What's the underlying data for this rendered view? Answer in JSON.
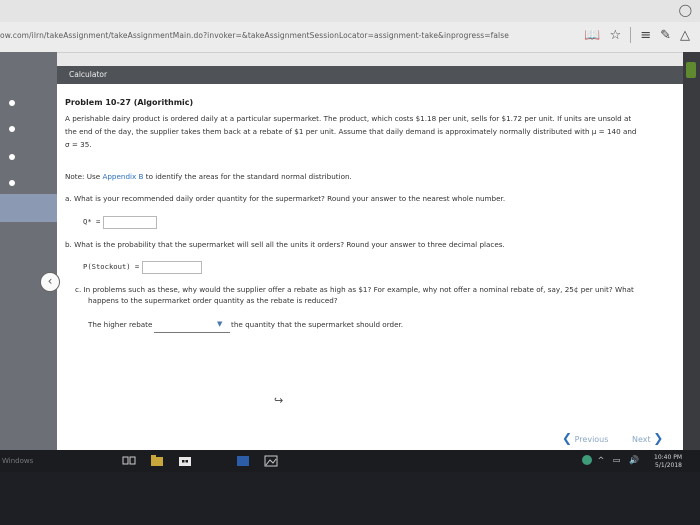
{
  "browser": {
    "url": "ow.com/ilrn/takeAssignment/takeAssignmentMain.do?invoker=&takeAssignmentSessionLocator=assignment-take&inprogress=false",
    "icons": [
      "reading-view-icon",
      "star-icon",
      "hub-icon",
      "note-icon",
      "share-icon"
    ]
  },
  "toolbar": {
    "calculator_label": "Calculator"
  },
  "problem": {
    "title": "Problem 10-27 (Algorithmic)",
    "text_line1": "A perishable dairy product is ordered daily at a particular supermarket. The product, which costs $1.18 per unit, sells for $1.72 per unit. If units are unsold at",
    "text_line2": "the end of the day, the supplier takes them back at a rebate of $1 per unit. Assume that daily demand is approximately normally distributed with μ = 140 and",
    "text_line3": "σ = 35.",
    "note_prefix": "Note: Use ",
    "note_link": "Appendix B",
    "note_suffix": " to identify the areas for the standard normal distribution.",
    "part_a": {
      "question": "a.  What is your recommended daily order quantity for the supermarket? Round your answer to the nearest whole number.",
      "label": "Q* =",
      "value": ""
    },
    "part_b": {
      "question": "b.  What is the probability that the supermarket will sell all the units it orders? Round your answer to three decimal places.",
      "label": "P(Stockout) =",
      "value": ""
    },
    "part_c": {
      "question_line1": "c.  In problems such as these, why would the supplier offer a rebate as high as $1? For example, why not offer a nominal rebate of, say, 25¢ per unit? What",
      "question_line2": "happens to the supermarket order quantity as the rebate is reduced?",
      "prefix": "The higher rebate",
      "dropdown_value": "",
      "suffix": "the quantity that the supermarket should order."
    }
  },
  "navigation": {
    "previous_label": "Previous",
    "next_label": "Next"
  },
  "taskbar": {
    "start_label": "Windows",
    "time": "10:40 PM",
    "date": "5/1/2018"
  }
}
